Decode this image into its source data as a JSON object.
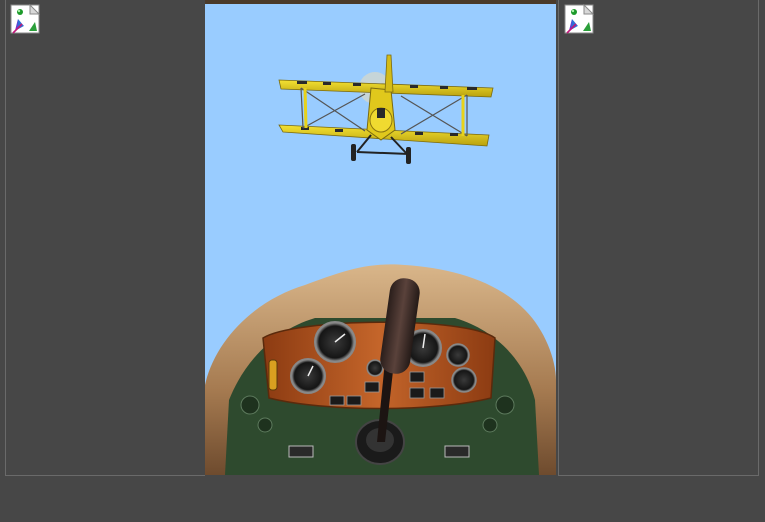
{
  "layout": {
    "background_color": "#474747",
    "panel_border_color": "#6a6a6a"
  },
  "left_panel": {
    "image_icon": "broken-image-icon"
  },
  "right_panel": {
    "image_icon": "broken-image-icon"
  },
  "game": {
    "sky_color": "#99ccff",
    "enemy_plane": {
      "type": "biplane",
      "color": "#e8d21a",
      "stripe_color": "#2a2a2a"
    },
    "cockpit": {
      "cowling_color": "#c9a57a",
      "panel_color": "#b4531f",
      "stick_color": "#3a2a26",
      "floor_color": "#2e4a2e"
    }
  }
}
